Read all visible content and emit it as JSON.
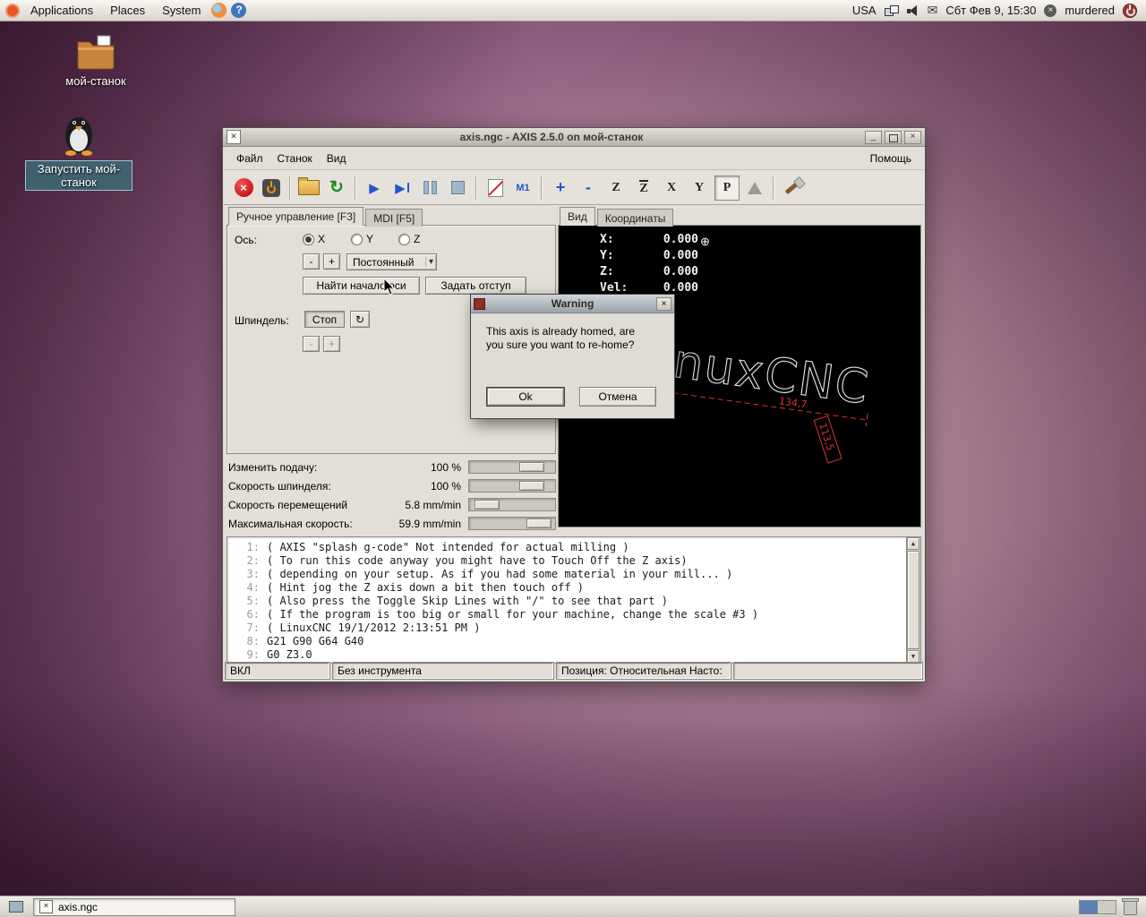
{
  "panel": {
    "menus": [
      {
        "label": "Applications"
      },
      {
        "label": "Places"
      },
      {
        "label": "System"
      }
    ],
    "keyboard_layout": "USA",
    "clock": "Сбт Фев 9, 15:30",
    "user": "murdered"
  },
  "desktop_icons": {
    "folder": "мой-станок",
    "launcher": "Запустить мой-станок"
  },
  "icons": {
    "estop": "×",
    "reload": "↻",
    "run": "▶",
    "step": "▶",
    "m1": "M1",
    "zoom_in": "+",
    "zoom_out": "-",
    "view_z": "Z",
    "view_z2": "Z",
    "view_x": "X",
    "view_y": "Y",
    "view_p": "P",
    "dropdown": "▾",
    "spindle_turn": "↻",
    "origin": "⊕",
    "mail": "✉",
    "help": "?",
    "presence": "×",
    "minimize": "_",
    "close": "×",
    "scroll_up": "▲",
    "scroll_down": "▼",
    "window_glyph": "✕"
  },
  "win": {
    "title": "axis.ngc - AXIS 2.5.0 on мой-станок",
    "menu_file": "Файл",
    "menu_machine": "Станок",
    "menu_view": "Вид",
    "menu_help": "Помощь",
    "tab_manual": "Ручное управление [F3]",
    "tab_mdi": "MDI [F5]",
    "axis_label": "Ось:",
    "axis_x": "X",
    "axis_y": "Y",
    "axis_z": "Z",
    "jog_minus": "-",
    "jog_plus": "+",
    "jog_mode": "Постоянный",
    "home_button": "Найти начало оси",
    "offset_button": "Задать отступ",
    "spindle_label": "Шпиндель:",
    "spindle_stop": "Стоп",
    "spindle_minus": "-",
    "spindle_plus": "+",
    "overrides": [
      {
        "label": "Изменить подачу:",
        "value": "100 %"
      },
      {
        "label": "Скорость шпинделя:",
        "value": "100 %"
      },
      {
        "label": "Скорость перемещений",
        "value": "5.8 mm/min"
      },
      {
        "label": "Максимальная скорость:",
        "value": "59.9 mm/min"
      }
    ],
    "tab_view": "Вид",
    "tab_coords": "Координаты",
    "dro": [
      {
        "label": "X:",
        "value": "0.000"
      },
      {
        "label": "Y:",
        "value": "0.000"
      },
      {
        "label": "Z:",
        "value": "0.000"
      },
      {
        "label": "Vel:",
        "value": "0.000"
      }
    ],
    "preview": {
      "logo": "LinuxCNC",
      "dim_length": "134,7",
      "dim_height": "113,5"
    },
    "gcode": [
      {
        "n": "1:",
        "text": "( AXIS \"splash g-code\" Not intended for actual milling )"
      },
      {
        "n": "2:",
        "text": "( To run this code anyway you might have to Touch Off the Z axis)"
      },
      {
        "n": "3:",
        "text": "( depending on your setup. As if you had some material in your mill... )"
      },
      {
        "n": "4:",
        "text": "( Hint jog the Z axis down a bit then touch off )"
      },
      {
        "n": "5:",
        "text": "( Also press the Toggle Skip Lines with \"/\" to see that part )"
      },
      {
        "n": "6:",
        "text": "( If the program is too big or small for your machine, change the scale #3 )"
      },
      {
        "n": "7:",
        "text": "( LinuxCNC 19/1/2012 2:13:51 PM )"
      },
      {
        "n": "8:",
        "text": "G21 G90 G64 G40"
      },
      {
        "n": "9:",
        "text": "G0 Z3.0"
      }
    ],
    "status_power": "ВКЛ",
    "status_tool": "Без инструмента",
    "status_position": "Позиция: Относительная Насто:"
  },
  "dialog": {
    "title": "Warning",
    "line1": "This axis is already homed, are",
    "line2": "you sure you want to re-home?",
    "ok": "Ok",
    "cancel": "Отмена"
  },
  "taskbar": {
    "window": "axis.ngc"
  }
}
